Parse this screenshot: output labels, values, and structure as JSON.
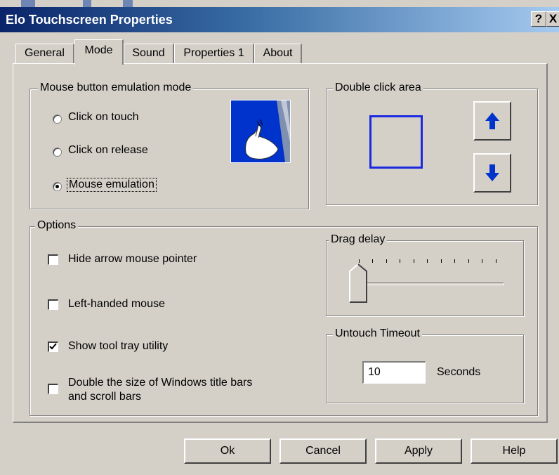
{
  "window": {
    "title": "Elo Touchscreen Properties",
    "help_button": "?",
    "close_button": "X"
  },
  "tabs": [
    {
      "label": "General",
      "active": false
    },
    {
      "label": "Mode",
      "active": true
    },
    {
      "label": "Sound",
      "active": false
    },
    {
      "label": "Properties 1",
      "active": false
    },
    {
      "label": "About",
      "active": false
    }
  ],
  "mouse_emulation": {
    "title": "Mouse button emulation mode",
    "options": [
      {
        "label": "Click on touch",
        "selected": false
      },
      {
        "label": "Click on release",
        "selected": false
      },
      {
        "label": "Mouse emulation",
        "selected": true
      }
    ],
    "illustration_icon": "touch-hand-icon"
  },
  "double_click_area": {
    "title": "Double click area",
    "increase_icon": "arrow-up-icon",
    "decrease_icon": "arrow-down-icon"
  },
  "options": {
    "title": "Options",
    "checkboxes": [
      {
        "label": "Hide arrow mouse pointer",
        "checked": false
      },
      {
        "label": "Left-handed mouse",
        "checked": false
      },
      {
        "label": "Show tool tray utility",
        "checked": true
      },
      {
        "label_line1": "Double the size of Windows title bars",
        "label_line2": "and scroll bars",
        "checked": false
      }
    ]
  },
  "drag_delay": {
    "title": "Drag delay",
    "slider_level": 0
  },
  "untouch_timeout": {
    "title": "Untouch Timeout",
    "value": "10",
    "unit": "Seconds"
  },
  "buttons": {
    "ok": "Ok",
    "cancel": "Cancel",
    "apply": "Apply",
    "help": "Help"
  },
  "colors": {
    "face": "#d4d0c8",
    "title_start": "#0a246a",
    "title_end": "#a6caf0",
    "accent_blue": "#0033cc"
  }
}
